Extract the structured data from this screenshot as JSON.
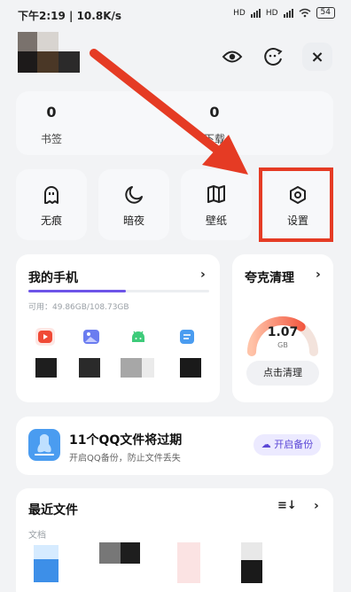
{
  "status_bar": {
    "time_speed": "下午2:19 | 10.8K/s",
    "network": "HD",
    "battery": "54"
  },
  "header": {
    "close_label": "×",
    "icons": [
      "eye-icon",
      "emoji-face-icon",
      "close-icon"
    ]
  },
  "bookmarks": {
    "items": [
      {
        "count": "0",
        "label": "书签"
      },
      {
        "count": "0",
        "label": "下载"
      }
    ]
  },
  "quick_actions": [
    {
      "label": "无痕",
      "icon": "ghost-icon"
    },
    {
      "label": "暗夜",
      "icon": "moon-icon"
    },
    {
      "label": "壁纸",
      "icon": "book-icon"
    },
    {
      "label": "设置",
      "icon": "hexagon-settings-icon"
    }
  ],
  "my_phone": {
    "title": "我的手机",
    "storage": "可用：49.86GB/108.73GB",
    "storage_used_fraction": 0.54,
    "apps": [
      "video-app-icon",
      "gallery-app-icon",
      "android-app-icon",
      "files-app-icon"
    ]
  },
  "cleaner": {
    "title": "夸克清理",
    "value": "1.07",
    "unit": "GB",
    "button": "点击清理",
    "gauge_fraction": 0.7
  },
  "qq_files": {
    "title": "11个QQ文件将过期",
    "subtitle": "开启QQ备份，防止文件丢失",
    "button": "开启备份"
  },
  "recent_files": {
    "title": "最近文件",
    "subtitle": "文档"
  },
  "colors": {
    "accent": "#6d54e8",
    "annotation_red": "#e53b24",
    "gauge_start": "#ffc3a8",
    "gauge_end": "#f0432c"
  }
}
